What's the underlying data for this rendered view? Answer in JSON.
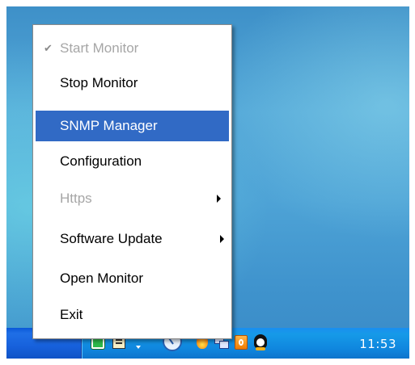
{
  "menu": {
    "items": [
      {
        "label": "Start Monitor",
        "checked": true,
        "enabled": false,
        "highlighted": false,
        "submenu": false
      },
      {
        "label": "Stop Monitor",
        "checked": false,
        "enabled": true,
        "highlighted": false,
        "submenu": false
      },
      {
        "label": "SNMP Manager",
        "checked": false,
        "enabled": true,
        "highlighted": true,
        "submenu": false
      },
      {
        "label": "Configuration",
        "checked": false,
        "enabled": true,
        "highlighted": false,
        "submenu": false
      },
      {
        "label": "Https",
        "checked": false,
        "enabled": false,
        "highlighted": false,
        "submenu": true
      },
      {
        "label": "Software Update",
        "checked": false,
        "enabled": true,
        "highlighted": false,
        "submenu": true
      },
      {
        "label": "Open Monitor",
        "checked": false,
        "enabled": true,
        "highlighted": false,
        "submenu": false
      },
      {
        "label": "Exit",
        "checked": false,
        "enabled": true,
        "highlighted": false,
        "submenu": false
      }
    ],
    "check_glyph": "✔"
  },
  "taskbar": {
    "clock": "11:53",
    "tray_icons": [
      "green-app-icon",
      "card-icon",
      "expand-arrow-icon",
      "clock-icon",
      "flame-icon",
      "network-icon",
      "office-icon",
      "penguin-icon"
    ]
  },
  "colors": {
    "highlight": "#316ac5",
    "disabled_text": "#a6a6a6",
    "taskbar": "#1761dc",
    "tray": "#0f86de"
  }
}
